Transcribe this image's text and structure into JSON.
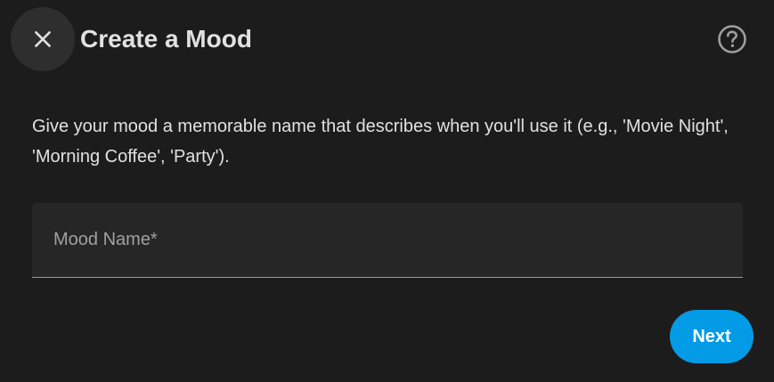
{
  "dialog": {
    "title": "Create a Mood",
    "close_icon": "close-icon",
    "help_icon": "help-circle-icon",
    "description": "Give your mood a memorable name that describes when you'll use it (e.g., 'Movie Night', 'Morning Coffee', 'Party').",
    "mood_name_field": {
      "label": "Mood Name*",
      "value": ""
    },
    "next_label": "Next"
  },
  "colors": {
    "background": "#1c1c1c",
    "close_button_bg": "#2e2e2e",
    "field_bg": "#262626",
    "accent": "#039be5",
    "text": "#e1e1e1",
    "muted_text": "#a0a0a0"
  }
}
